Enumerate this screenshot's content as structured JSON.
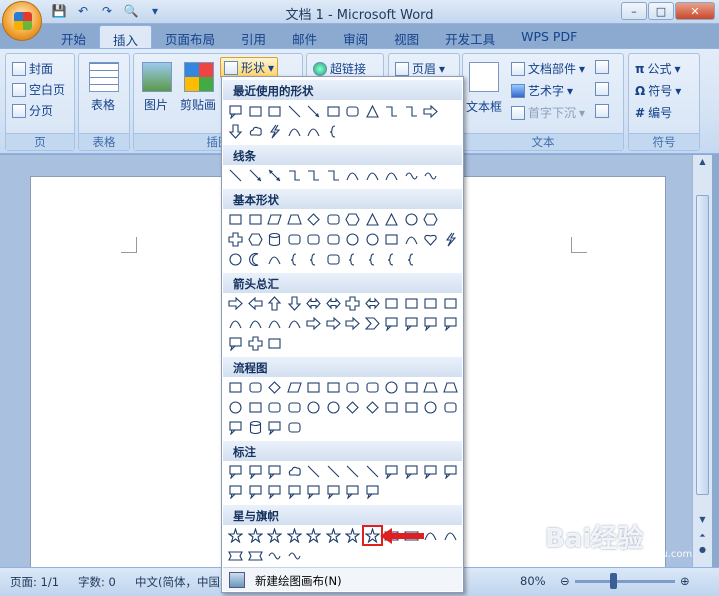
{
  "window": {
    "title": "文档 1 - Microsoft Word",
    "controls": [
      "–",
      "□",
      "✕"
    ]
  },
  "qat": {
    "items": [
      "save-icon",
      "undo-icon",
      "redo-icon",
      "print-preview-icon"
    ],
    "more": "▾"
  },
  "tabs": [
    "开始",
    "插入",
    "页面布局",
    "引用",
    "邮件",
    "审阅",
    "视图",
    "开发工具",
    "WPS PDF"
  ],
  "ribbon": {
    "page_group": {
      "cover": "封面",
      "blank": "空白页",
      "break": "分页",
      "label": "页"
    },
    "table_group": {
      "table": "表格",
      "label": "表格"
    },
    "illus_group": {
      "picture": "图片",
      "clipart": "剪贴画",
      "shapes": "形状",
      "label": "插图"
    },
    "links_group": {
      "hyperlink": "超链接"
    },
    "header_group": {
      "header": "页眉"
    },
    "text_group": {
      "textbox": "文本框",
      "docparts": "文档部件",
      "wordart": "艺术字",
      "dropcap": "首字下沉",
      "label": "文本"
    },
    "symbol_group": {
      "equation": "公式",
      "symbol": "符号",
      "number": "编号",
      "label": "符号"
    }
  },
  "menu": {
    "sections": {
      "recent": "最近使用的形状",
      "lines": "线条",
      "basic": "基本形状",
      "arrows": "箭头总汇",
      "flowchart": "流程图",
      "callouts": "标注",
      "stars": "星与旗帜"
    },
    "footer": "新建绘图画布(N)"
  },
  "statusbar": {
    "page": "页面: 1/1",
    "words": "字数: 0",
    "language": "中文(简体，中国",
    "zoom": "80%"
  },
  "watermark": {
    "brand": "Bai经验",
    "sub": "jingyan.baidu.com"
  }
}
